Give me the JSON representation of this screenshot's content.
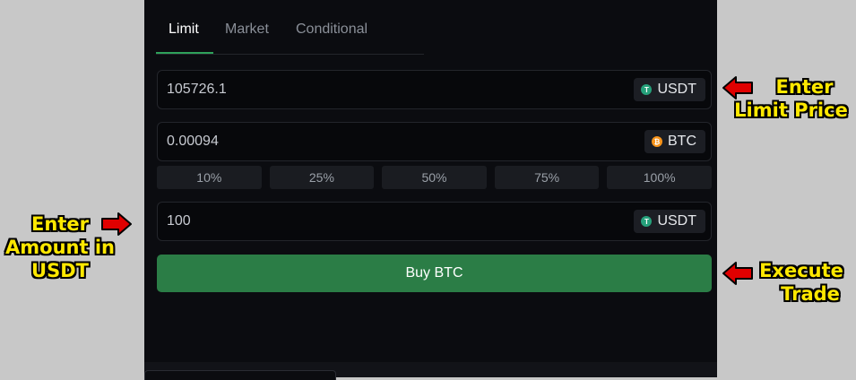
{
  "tabs": [
    {
      "label": "Limit",
      "active": true
    },
    {
      "label": "Market",
      "active": false
    },
    {
      "label": "Conditional",
      "active": false
    }
  ],
  "price_field": {
    "value": "105726.1",
    "unit": "USDT",
    "unit_icon": "usdt-icon"
  },
  "quantity_field": {
    "value": "0.00094",
    "unit": "BTC",
    "unit_icon": "btc-icon"
  },
  "percent_options": [
    "10%",
    "25%",
    "50%",
    "75%",
    "100%"
  ],
  "amount_field": {
    "value": "100",
    "unit": "USDT",
    "unit_icon": "usdt-icon"
  },
  "buy_button": {
    "label": "Buy BTC"
  },
  "annotations": {
    "limit_price": {
      "line1": "Enter",
      "line2": "Limit Price"
    },
    "amount": {
      "line1": "Enter",
      "line2": "Amount in",
      "line3": "USDT"
    },
    "execute": {
      "line1": "Execute",
      "line2": "Trade"
    }
  },
  "colors": {
    "accent_green": "#2b7d46",
    "tab_underline": "#2ea15a",
    "annotation_text": "#ffe800",
    "annotation_arrow": "#e00000",
    "usdt": "#26a17b",
    "btc": "#f7931a"
  }
}
